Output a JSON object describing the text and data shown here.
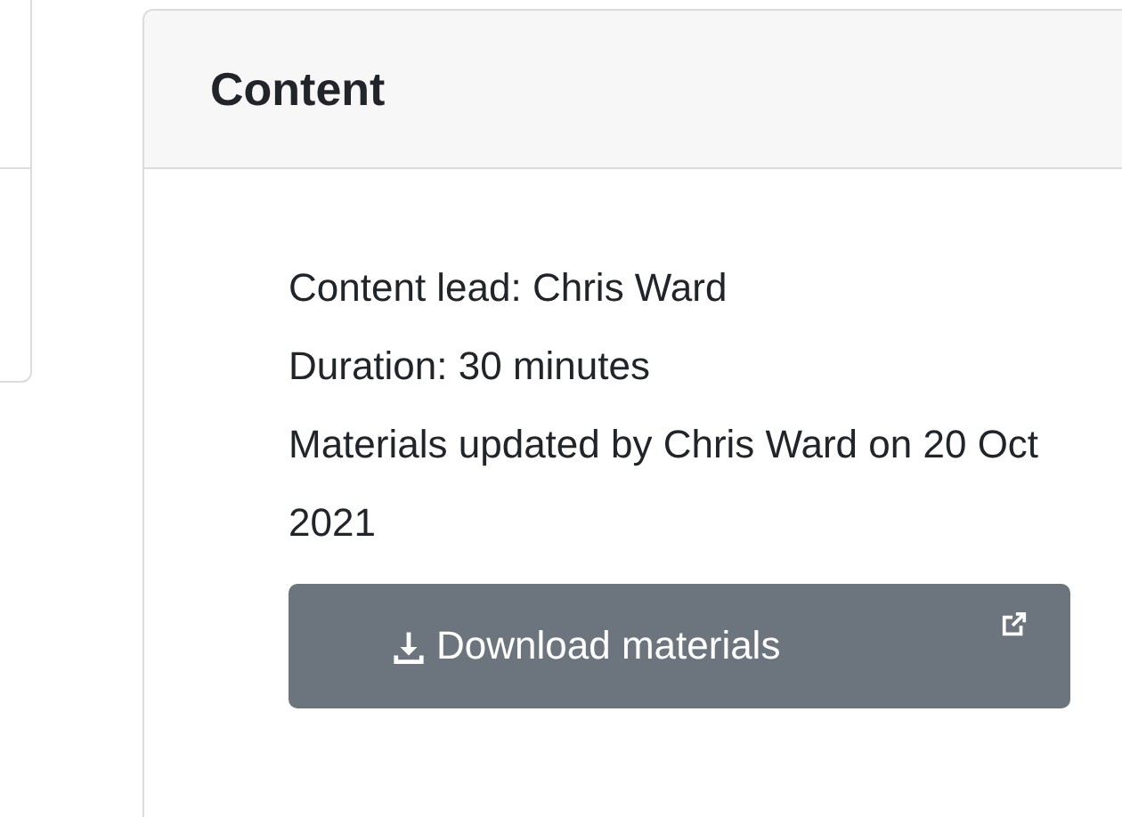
{
  "card": {
    "title": "Content",
    "lines": [
      "Content lead: Chris Ward",
      "Duration: 30 minutes",
      "Materials updated by Chris Ward on 20 Oct 2021"
    ],
    "button": {
      "label": "Download materials"
    }
  }
}
